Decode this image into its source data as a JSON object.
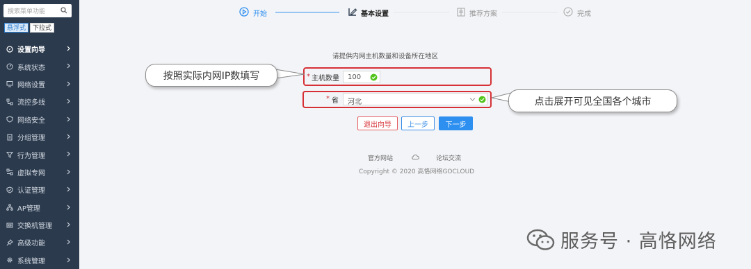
{
  "sidebar": {
    "search_placeholder": "搜索菜单功能",
    "mode_tabs": [
      "悬浮式",
      "下拉式"
    ],
    "items": [
      {
        "label": "设置向导",
        "icon": "compass-icon",
        "active": true
      },
      {
        "label": "系统状态",
        "icon": "gauge-icon"
      },
      {
        "label": "网络设置",
        "icon": "monitor-icon"
      },
      {
        "label": "流控多线",
        "icon": "flow-icon"
      },
      {
        "label": "网络安全",
        "icon": "shield-icon"
      },
      {
        "label": "分组管理",
        "icon": "document-icon"
      },
      {
        "label": "行为管理",
        "icon": "filter-icon"
      },
      {
        "label": "虚拟专网",
        "icon": "vpn-icon"
      },
      {
        "label": "认证管理",
        "icon": "shield-check-icon"
      },
      {
        "label": "AP管理",
        "icon": "network-tree-icon"
      },
      {
        "label": "交换机管理",
        "icon": "switch-icon"
      },
      {
        "label": "高级功能",
        "icon": "pin-icon"
      },
      {
        "label": "系统管理",
        "icon": "gear-icon"
      }
    ]
  },
  "steps": [
    {
      "label": "开始",
      "state": "done"
    },
    {
      "label": "基本设置",
      "state": "active"
    },
    {
      "label": "推荐方案",
      "state": "pending"
    },
    {
      "label": "完成",
      "state": "pending"
    }
  ],
  "form": {
    "hint": "请提供内网主机数量和设备所在地区",
    "host_label": "主机数量",
    "host_value": "100",
    "province_label": "省",
    "province_value": "河北",
    "required_mark": "*"
  },
  "callouts": {
    "left": "按照实际内网IP数填写",
    "right": "点击展开可见全国各个城市"
  },
  "buttons": {
    "exit": "退出向导",
    "prev": "上一步",
    "next": "下一步"
  },
  "footer": {
    "official_site": "官方网站",
    "forum": "论坛交流",
    "copyright": "Copyright © 2020 高恪网络GOCLOUD"
  },
  "watermark": {
    "text": "服务号 · 高恪网络"
  },
  "colors": {
    "sidebar_bg": "#2b3a4d",
    "accent_blue": "#2d8ff0",
    "highlight_red": "#d63036",
    "valid_green": "#52c41a"
  }
}
